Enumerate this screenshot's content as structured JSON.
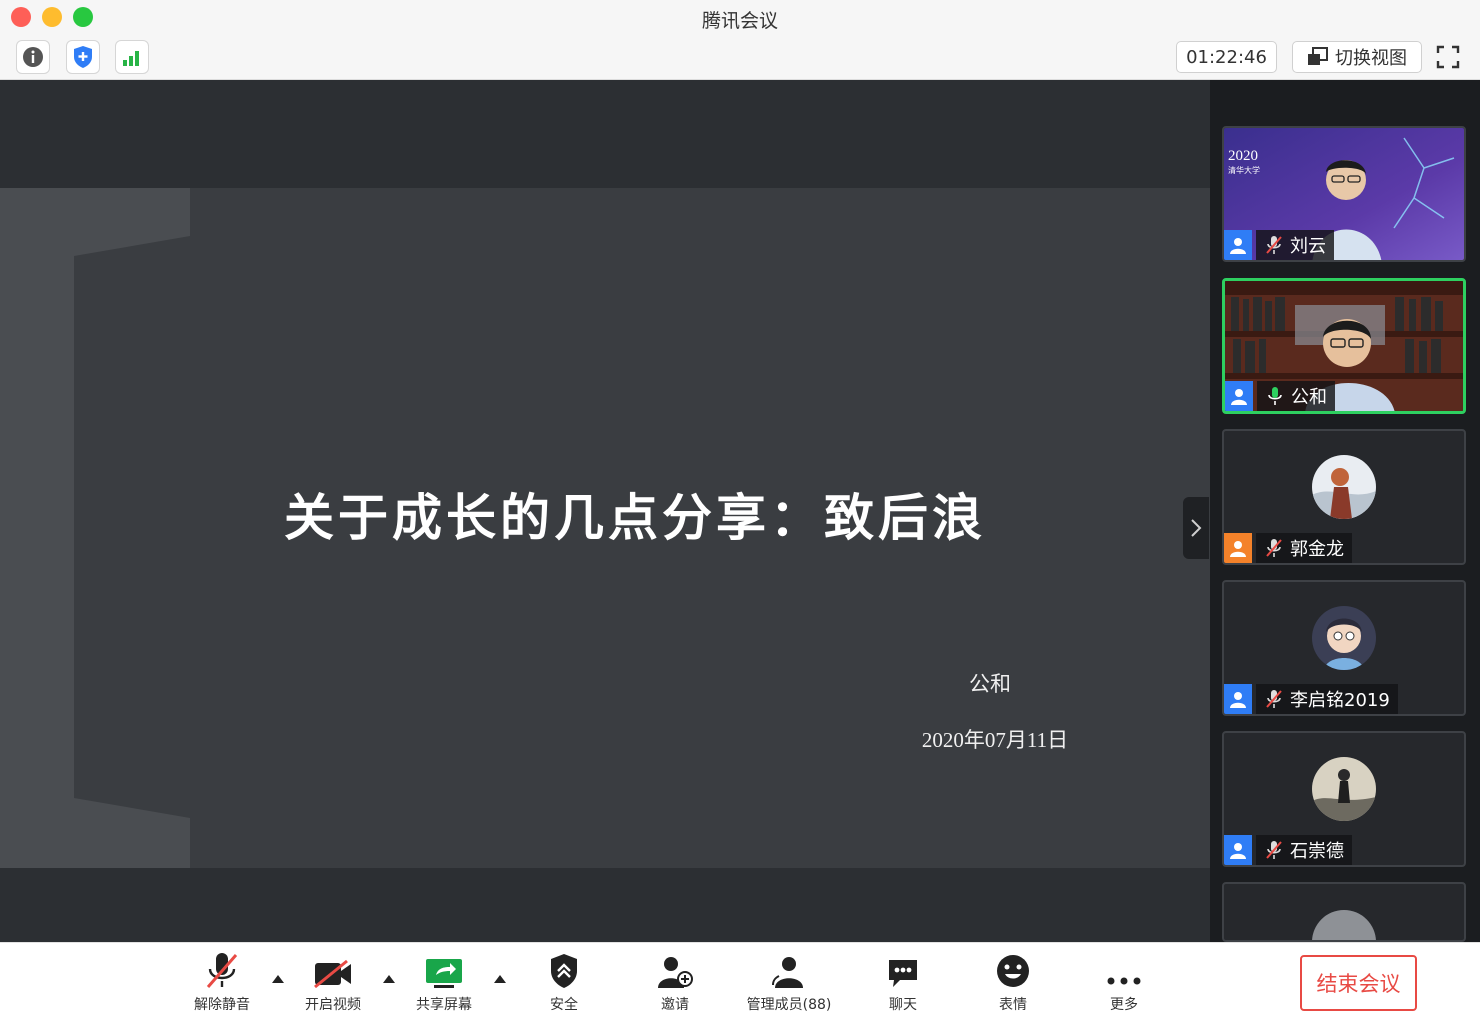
{
  "window": {
    "title": "腾讯会议",
    "controls": {
      "close": "#fe5f57",
      "minimize": "#febc2e",
      "maximize": "#28c840"
    }
  },
  "toolbar": {
    "icons": [
      "info-icon",
      "security-shield-icon",
      "signal-strength-icon"
    ],
    "timer": "01:22:46",
    "switch_view_label": "切换视图",
    "fullscreen_icon": "fullscreen-icon"
  },
  "slide": {
    "title": "关于成长的几点分享：致后浪",
    "author": "公和",
    "date": "2020年07月11日"
  },
  "participants": [
    {
      "name": "刘云",
      "mic": "muted",
      "role_color": "#2f7df6",
      "video": "on",
      "video_text": {
        "year": "2020",
        "subtitle": "清华大学"
      }
    },
    {
      "name": "公和",
      "mic": "speaking",
      "role_color": "#2f7df6",
      "video": "on",
      "active": true
    },
    {
      "name": "郭金龙",
      "mic": "muted",
      "role_color": "#f4822a",
      "video": "avatar"
    },
    {
      "name": "李启铭2019",
      "mic": "muted",
      "role_color": "#2f7df6",
      "video": "avatar"
    },
    {
      "name": "石崇德",
      "mic": "muted",
      "role_color": "#2f7df6",
      "video": "avatar"
    }
  ],
  "bottom_bar": {
    "unmute": "解除静音",
    "start_video": "开启视频",
    "share_screen": "共享屏幕",
    "security": "安全",
    "invite": "邀请",
    "manage_members": "管理成员(88)",
    "chat": "聊天",
    "reactions": "表情",
    "more": "更多",
    "end_meeting": "结束会议"
  },
  "colors": {
    "accent_green": "#2ed060",
    "end_red": "#e84a44",
    "role_blue": "#2f7df6",
    "role_orange": "#f4822a"
  }
}
